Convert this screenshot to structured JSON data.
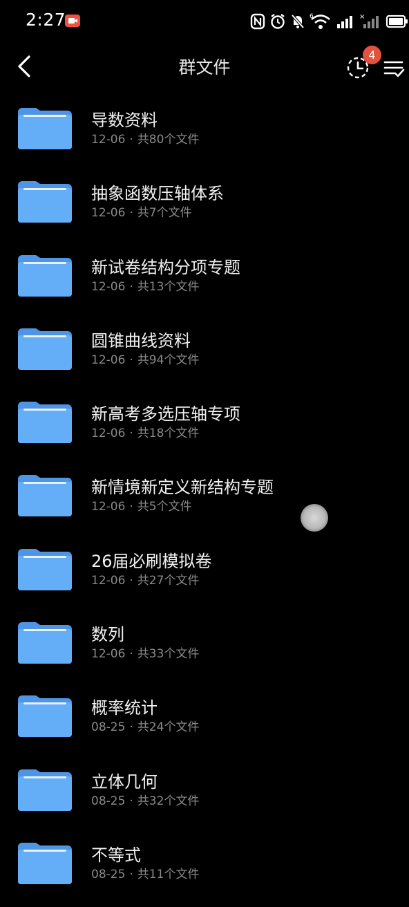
{
  "status_bar": {
    "time": "2:27",
    "icons": [
      "nfc-icon",
      "alarm-icon",
      "mute-icon",
      "wifi-icon",
      "signal-icon",
      "signal-no-sim-icon",
      "battery-icon"
    ]
  },
  "header": {
    "title": "群文件",
    "history_badge_count": "4"
  },
  "folders": [
    {
      "name": "导数资料",
      "date": "12-06",
      "count": "共80个文件"
    },
    {
      "name": "抽象函数压轴体系",
      "date": "12-06",
      "count": "共7个文件"
    },
    {
      "name": "新试卷结构分项专题",
      "date": "12-06",
      "count": "共13个文件"
    },
    {
      "name": "圆锥曲线资料",
      "date": "12-06",
      "count": "共94个文件"
    },
    {
      "name": "新高考多选压轴专项",
      "date": "12-06",
      "count": "共18个文件"
    },
    {
      "name": "新情境新定义新结构专题",
      "date": "12-06",
      "count": "共5个文件"
    },
    {
      "name": "26届必刷模拟卷",
      "date": "12-06",
      "count": "共27个文件"
    },
    {
      "name": "数列",
      "date": "12-06",
      "count": "共33个文件"
    },
    {
      "name": "概率统计",
      "date": "08-25",
      "count": "共24个文件"
    },
    {
      "name": "立体几何",
      "date": "08-25",
      "count": "共32个文件"
    },
    {
      "name": "不等式",
      "date": "08-25",
      "count": "共11个文件"
    }
  ],
  "colors": {
    "background": "#000000",
    "folder_blue": "#5ea8f5",
    "badge_red": "#e4513d",
    "meta_gray": "#8a8a8a"
  }
}
